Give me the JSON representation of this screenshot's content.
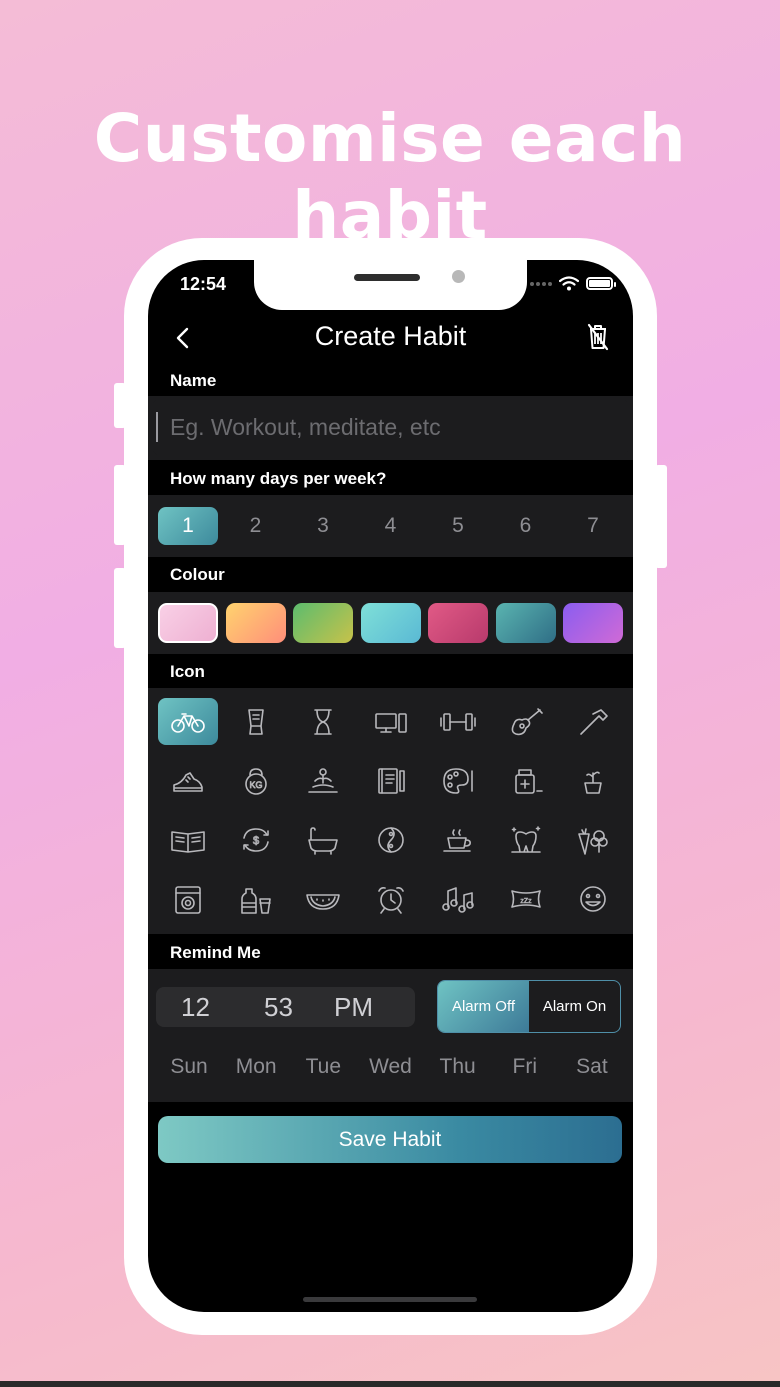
{
  "headline": "Customise each habit",
  "status": {
    "time": "12:54"
  },
  "nav": {
    "title": "Create Habit"
  },
  "name_section": {
    "label": "Name",
    "placeholder": "Eg. Workout, meditate, etc"
  },
  "days_section": {
    "label": "How many days per week?",
    "options": [
      "1",
      "2",
      "3",
      "4",
      "5",
      "6",
      "7"
    ],
    "selected": "1"
  },
  "colour_section": {
    "label": "Colour",
    "swatches": [
      "#f6c1dd",
      "#ffb36b",
      "#8ec46a",
      "#6ed4d4",
      "#d9467c",
      "#3f8f9c",
      "#a64ce6"
    ],
    "selected_index": 0
  },
  "icon_section": {
    "label": "Icon",
    "icons": [
      "bicycle-icon",
      "blender-icon",
      "hourglass-icon",
      "computer-icon",
      "dumbbell-icon",
      "guitar-icon",
      "hammer-icon",
      "sneaker-icon",
      "kettlebell-icon",
      "meditation-icon",
      "notebook-icon",
      "palette-icon",
      "medicine-icon",
      "plant-icon",
      "book-icon",
      "money-cycle-icon",
      "bathtub-icon",
      "yin-yang-icon",
      "tea-icon",
      "tooth-icon",
      "vegetables-icon",
      "washing-machine-icon",
      "bottles-icon",
      "watermelon-icon",
      "alarm-clock-icon",
      "music-icon",
      "pillow-icon",
      "smiley-icon"
    ],
    "selected_index": 0
  },
  "remind_section": {
    "label": "Remind Me",
    "hour": "12",
    "minute": "53",
    "period": "PM",
    "alarm_off": "Alarm Off",
    "alarm_on": "Alarm On",
    "weekdays": [
      "Sun",
      "Mon",
      "Tue",
      "Wed",
      "Thu",
      "Fri",
      "Sat"
    ]
  },
  "save_label": "Save Habit"
}
